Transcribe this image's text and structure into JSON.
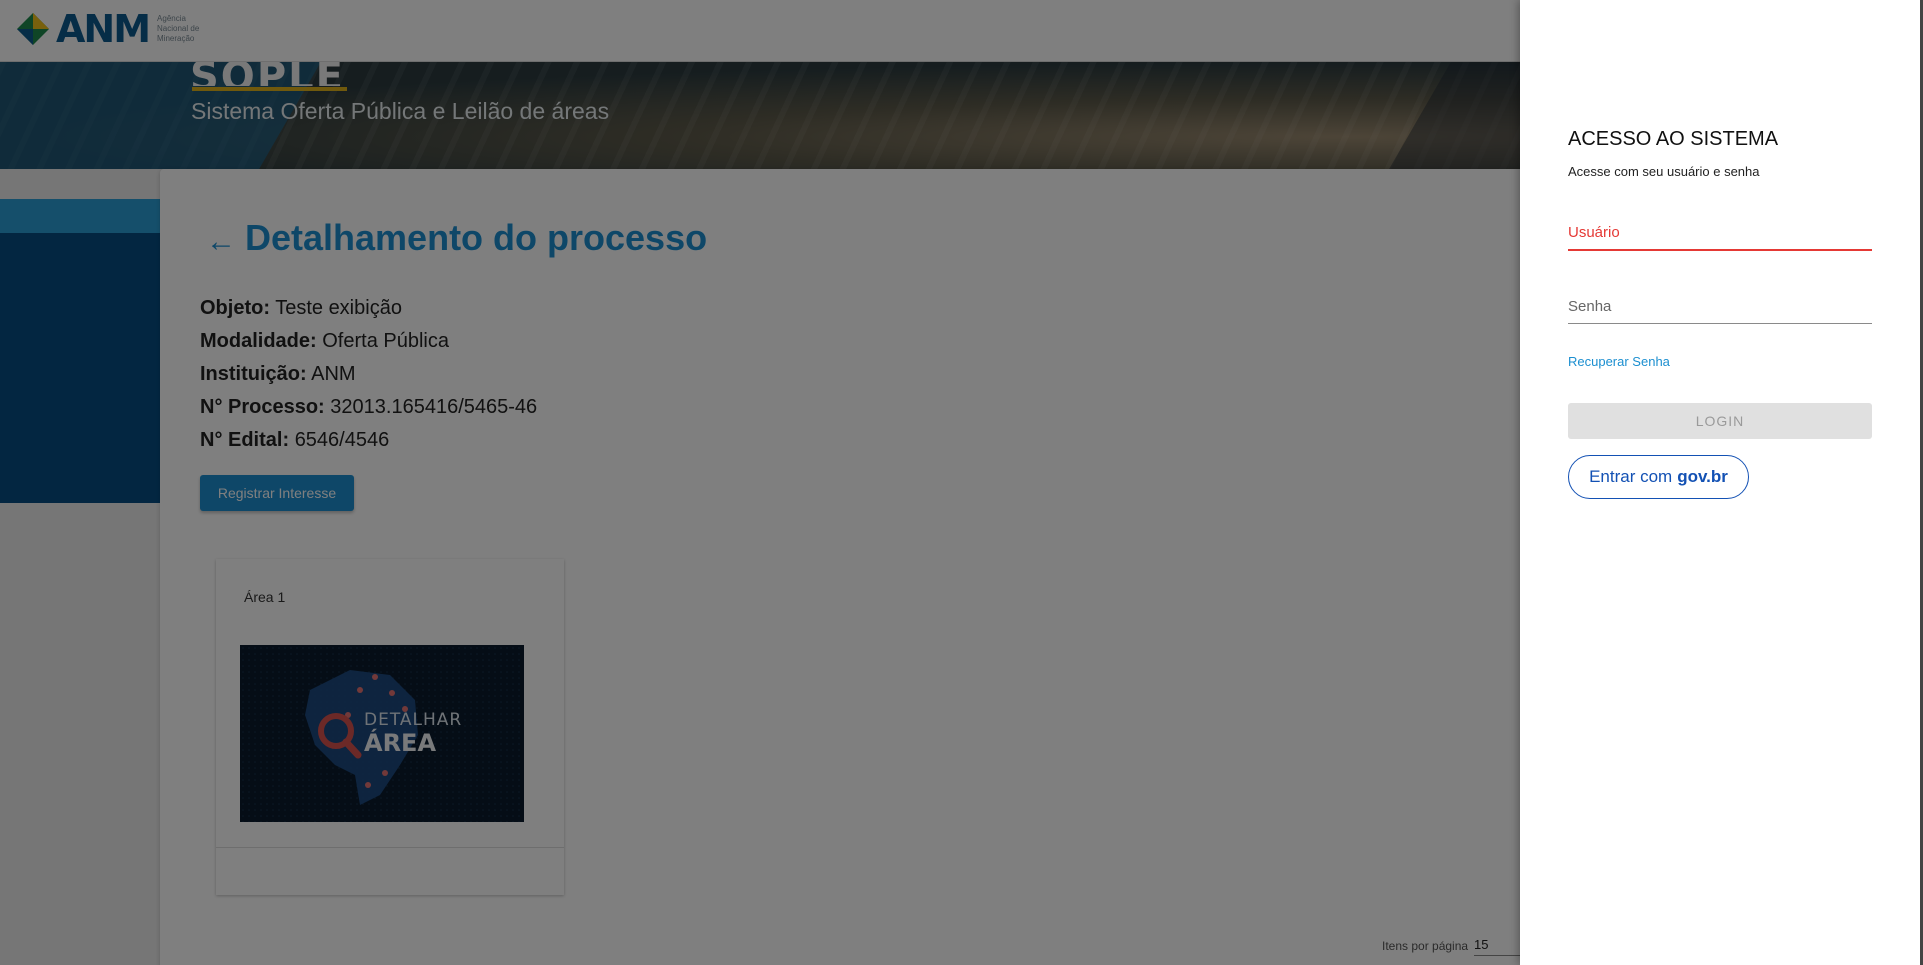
{
  "header": {
    "logo_text": "ANM",
    "logo_subtitle": "Agência Nacional de Mineração"
  },
  "hero": {
    "system_acronym": "SOPLE",
    "system_name": "Sistema Oferta Pública e Leilão de áreas"
  },
  "process": {
    "title": "Detalhamento do processo",
    "fields": [
      {
        "label": "Objeto:",
        "value": "Teste exibição"
      },
      {
        "label": "Modalidade:",
        "value": "Oferta Pública"
      },
      {
        "label": "Instituição:",
        "value": "ANM"
      },
      {
        "label": "N° Processo:",
        "value": "32013.165416/5465-46"
      },
      {
        "label": "N° Edital:",
        "value": "6546/4546"
      }
    ],
    "register_button": "Registrar Interesse"
  },
  "areas": [
    {
      "label": "Área 1",
      "thumb_line1": "DETALHAR",
      "thumb_line2": "ÁREA"
    }
  ],
  "pagination": {
    "items_per_page_label": "Itens por página",
    "items_per_page_value": "15"
  },
  "login": {
    "title": "ACESSO AO SISTEMA",
    "subtitle": "Acesse com seu usuário e senha",
    "username_placeholder": "Usuário",
    "password_placeholder": "Senha",
    "recover_link": "Recuperar Senha",
    "login_button": "LOGIN",
    "govbr_prefix": "Entrar com",
    "govbr_brand": "gov.br"
  },
  "colors": {
    "primary": "#1c8fd0",
    "dark_blue": "#064d83",
    "error": "#e53935",
    "govbr": "#1351b4"
  }
}
